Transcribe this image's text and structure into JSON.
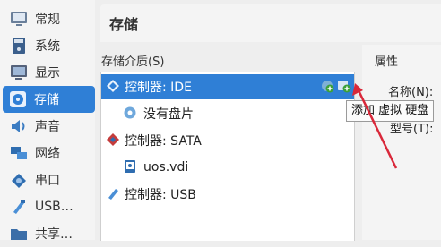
{
  "sidebar": {
    "items": [
      {
        "label": "常规",
        "icon": "general-icon"
      },
      {
        "label": "系统",
        "icon": "system-icon"
      },
      {
        "label": "显示",
        "icon": "display-icon"
      },
      {
        "label": "存储",
        "icon": "storage-icon"
      },
      {
        "label": "声音",
        "icon": "audio-icon"
      },
      {
        "label": "网络",
        "icon": "network-icon"
      },
      {
        "label": "串口",
        "icon": "serial-port-icon"
      },
      {
        "label": "USB…",
        "icon": "usb-icon"
      },
      {
        "label": "共享…",
        "icon": "shared-folder-icon"
      }
    ]
  },
  "header": {
    "title": "存储"
  },
  "tree": {
    "label": "存储介质(S)",
    "rows": [
      {
        "text": "控制器: IDE",
        "kind": "controller",
        "icon": "ide-controller-icon"
      },
      {
        "text": "没有盘片",
        "kind": "child",
        "icon": "optical-disc-icon"
      },
      {
        "text": "控制器: SATA",
        "kind": "controller",
        "icon": "sata-controller-icon"
      },
      {
        "text": "uos.vdi",
        "kind": "child",
        "icon": "hard-disk-icon"
      },
      {
        "text": "控制器: USB",
        "kind": "controller",
        "icon": "usb-controller-icon"
      }
    ]
  },
  "attributes": {
    "label": "属性",
    "name_label": "名称(N):",
    "type_label": "型号(T):"
  },
  "tooltip": {
    "text": "添加 虚拟 硬盘"
  },
  "colors": {
    "accent": "#2f7fd6",
    "arrow": "#d9283a",
    "add_icon": "#3da13a"
  }
}
